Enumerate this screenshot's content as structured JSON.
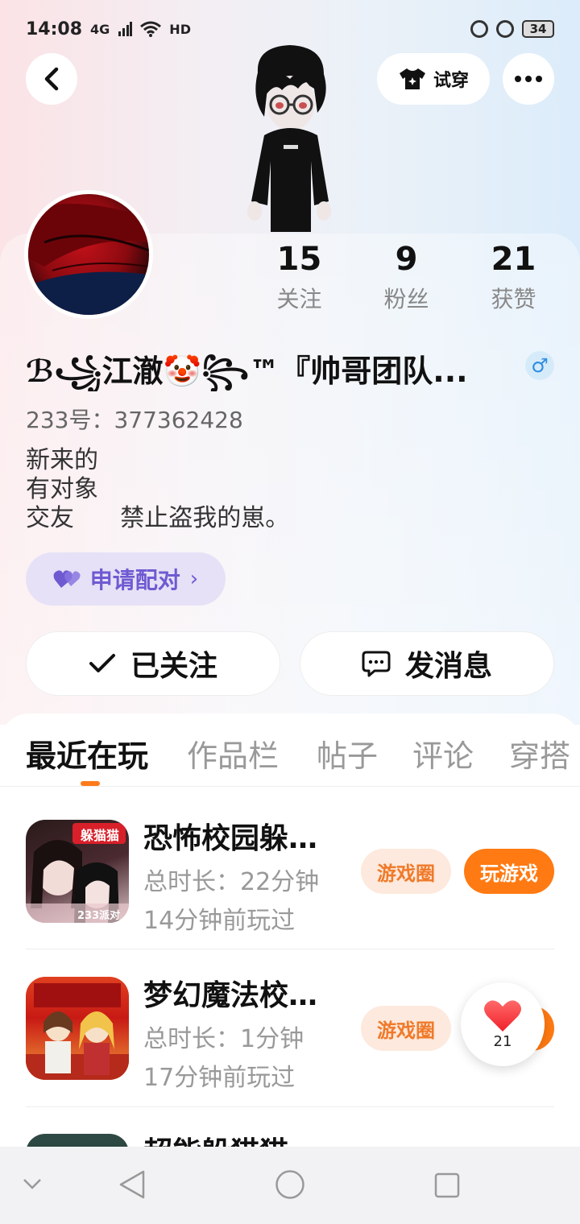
{
  "status_bar": {
    "time": "14:08",
    "signal": "4G",
    "hd": "HD",
    "battery": "34"
  },
  "header": {
    "try_on_label": "试穿"
  },
  "profile": {
    "stats": [
      {
        "value": "15",
        "label": "关注"
      },
      {
        "value": "9",
        "label": "粉丝"
      },
      {
        "value": "21",
        "label": "获赞"
      }
    ],
    "nickname": "ℬ꧁江澈🤡꧂™『帅哥团队...",
    "gender": "♂",
    "id_text": "233号：377362428",
    "bio": "新来的\n有对象\n交友      禁止盗我的崽。",
    "pair_label": "申请配对"
  },
  "actions": {
    "follow_label": "已关注",
    "message_label": "发消息"
  },
  "tabs": [
    "最近在玩",
    "作品栏",
    "帖子",
    "评论",
    "穿搭"
  ],
  "games": [
    {
      "title": "恐怖校园躲猫...",
      "duration": "总时长：22分钟",
      "last_played": "14分钟前玩过",
      "icon_text": "躲猫猫",
      "icon_sub": "233派对",
      "circle_label": "游戏圈",
      "play_label": "玩游戏"
    },
    {
      "title": "梦幻魔法校园...",
      "duration": "总时长：1分钟",
      "last_played": "17分钟前玩过",
      "circle_label": "游戏圈"
    },
    {
      "title": "超能躲猫猫"
    }
  ],
  "floating_like": {
    "count": "21"
  },
  "colors": {
    "accent": "#ff7a12",
    "pair_purple": "#6f5ad2",
    "gender_blue": "#2d8de0"
  }
}
